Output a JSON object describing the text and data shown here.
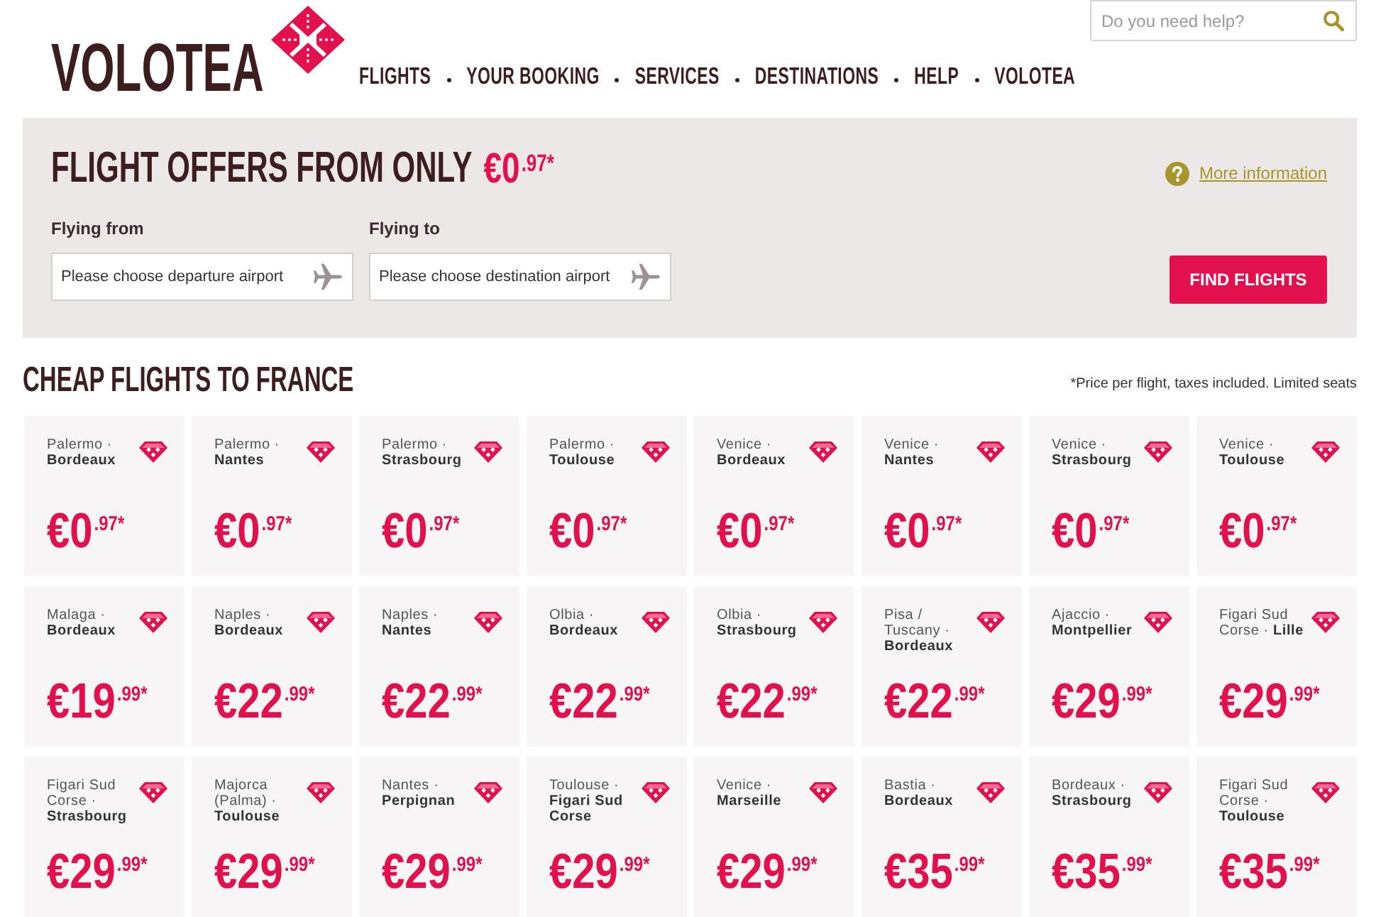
{
  "header": {
    "logo": "VOLOTEA",
    "nav": [
      {
        "label": "FLIGHTS"
      },
      {
        "label": "YOUR BOOKING"
      },
      {
        "label": "SERVICES"
      },
      {
        "label": "DESTINATIONS"
      },
      {
        "label": "HELP"
      },
      {
        "label": "VOLOTEA"
      }
    ],
    "search": {
      "placeholder": "Do you need help?"
    }
  },
  "offer_panel": {
    "title": "FLIGHT OFFERS FROM ONLY",
    "price": "€0$^{.97*}$",
    "more_info": "More information",
    "fields": [
      {
        "label": "Flying from",
        "placeholder": "Please choose departure airport"
      },
      {
        "label": "Flying to",
        "placeholder": "Please choose destination airport"
      }
    ],
    "button": "FIND FLIGHTS"
  },
  "deals": {
    "title": "CHEAP FLIGHTS TO FRANCE",
    "note": "*Price per flight, taxes included. Limited seats",
    "cards": [
      {
        "route": "Palermo · **Bordeaux**",
        "price": "€0$^{.97*}$"
      },
      {
        "route": "Palermo · **Nantes**",
        "price": "€0$^{.97*}$"
      },
      {
        "route": "Palermo · **Strasbourg**",
        "price": "€0$^{.97*}$"
      },
      {
        "route": "Palermo · **Toulouse**",
        "price": "€0$^{.97*}$"
      },
      {
        "route": "Venice · **Bordeaux**",
        "price": "€0$^{.97*}$"
      },
      {
        "route": "Venice · **Nantes**",
        "price": "€0$^{.97*}$"
      },
      {
        "route": "Venice · **Strasbourg**",
        "price": "€0$^{.97*}$"
      },
      {
        "route": "Venice · **Toulouse**",
        "price": "€0$^{.97*}$"
      },
      {
        "route": "Malaga · **Bordeaux**",
        "price": "€19$^{.99*}$"
      },
      {
        "route": "Naples · **Bordeaux**",
        "price": "€22$^{.99*}$"
      },
      {
        "route": "Naples · **Nantes**",
        "price": "€22$^{.99*}$"
      },
      {
        "route": "Olbia · **Bordeaux**",
        "price": "€22$^{.99*}$"
      },
      {
        "route": "Olbia · **Strasbourg**",
        "price": "€22$^{.99*}$"
      },
      {
        "route": "Pisa / Tuscany · **Bordeaux**",
        "price": "€22$^{.99*}$"
      },
      {
        "route": "Ajaccio · **Montpellier**",
        "price": "€29$^{.99*}$"
      },
      {
        "route": "Figari Sud Corse · **Lille**",
        "price": "€29$^{.99*}$"
      },
      {
        "route": "Figari Sud Corse · **Strasbourg**",
        "price": "€29$^{.99*}$"
      },
      {
        "route": "Majorca (Palma) · **Toulouse**",
        "price": "€29$^{.99*}$"
      },
      {
        "route": "Nantes · **Perpignan**",
        "price": "€29$^{.99*}$"
      },
      {
        "route": "Toulouse · **Figari Sud Corse**",
        "price": "€29$^{.99*}$"
      },
      {
        "route": "Venice · **Marseille**",
        "price": "€29$^{.99*}$"
      },
      {
        "route": "Bastia · **Bordeaux**",
        "price": "€35$^{.99*}$"
      },
      {
        "route": "Bordeaux · **Strasbourg**",
        "price": "€35$^{.99*}$"
      },
      {
        "route": "Figari Sud Corse · **Toulouse**",
        "price": "€35$^{.99*}$"
      }
    ]
  }
}
